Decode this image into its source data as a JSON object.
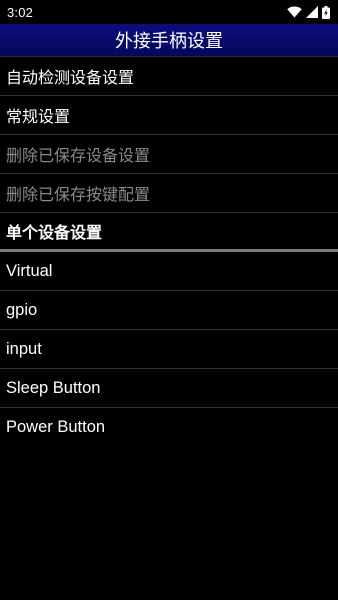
{
  "status_bar": {
    "time": "3:02",
    "icons": [
      "wifi-icon",
      "signal-icon",
      "battery-icon"
    ]
  },
  "title_bar": {
    "title": "外接手柄设置",
    "color": "#0b0e7c"
  },
  "settings": [
    {
      "label": "自动检测设备设置",
      "enabled": true
    },
    {
      "label": "常规设置",
      "enabled": true
    },
    {
      "label": "删除已保存设备设置",
      "enabled": false
    },
    {
      "label": "删除已保存按键配置",
      "enabled": false
    }
  ],
  "section_header": "单个设备设置",
  "devices": [
    {
      "label": "Virtual"
    },
    {
      "label": "gpio"
    },
    {
      "label": "input"
    },
    {
      "label": "Sleep Button"
    },
    {
      "label": "Power Button"
    }
  ]
}
